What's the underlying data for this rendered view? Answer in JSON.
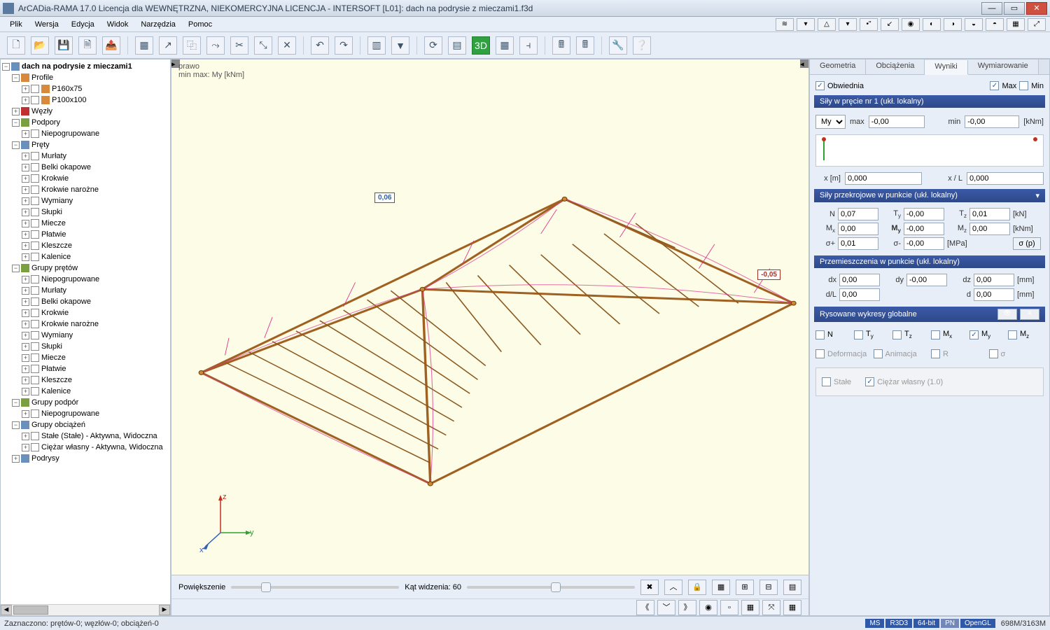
{
  "title": "ArCADia-RAMA 17.0 Licencja dla WEWNĘTRZNA, NIEKOMERCYJNA LICENCJA - INTERSOFT [L01]: dach na podrysie z mieczami1.f3d",
  "menu": [
    "Plik",
    "Wersja",
    "Edycja",
    "Widok",
    "Narzędzia",
    "Pomoc"
  ],
  "tree": {
    "root": "dach na podrysie z mieczami1",
    "profile": "Profile",
    "profiles": [
      "P160x75",
      "P100x100"
    ],
    "wezly": "Węzły",
    "podpory": "Podpory",
    "podpory_sub": [
      "Niepogrupowane"
    ],
    "prety": "Pręty",
    "prety_sub": [
      "Murłaty",
      "Belki okapowe",
      "Krokwie",
      "Krokwie narożne",
      "Wymiany",
      "Słupki",
      "Miecze",
      "Płatwie",
      "Kleszcze",
      "Kalenice"
    ],
    "grupy_pretow": "Grupy prętów",
    "grupy_pretow_sub": [
      "Niepogrupowane",
      "Murłaty",
      "Belki okapowe",
      "Krokwie",
      "Krokwie narożne",
      "Wymiany",
      "Słupki",
      "Miecze",
      "Płatwie",
      "Kleszcze",
      "Kalenice"
    ],
    "grupy_podpor": "Grupy podpór",
    "grupy_podpor_sub": [
      "Niepogrupowane"
    ],
    "grupy_obc": "Grupy obciążeń",
    "grupy_obc_sub": [
      "Stałe (Stałe) - Aktywna, Widoczna",
      "Ciężar własny - Aktywna, Widoczna"
    ],
    "podrysy": "Podrysy"
  },
  "viewport": {
    "label1": "prawo",
    "label2": "min max: My [kNm]",
    "annot_pos": "0,06",
    "annot_neg": "-0,05",
    "zoom_label": "Powiększenie",
    "angle_label": "Kąt widzenia: 60"
  },
  "right": {
    "tabs": [
      "Geometria",
      "Obciążenia",
      "Wyniki",
      "Wymiarowanie"
    ],
    "obwiednia": "Obwiednia",
    "max": "Max",
    "min": "Min",
    "sily_hdr": "Siły w pręcie nr 1 (ukł. lokalny)",
    "my_sel": "My",
    "max_lbl": "max",
    "max_val": "-0,00",
    "min_lbl": "min",
    "min_val": "-0,00",
    "unit_knm": "[kNm]",
    "x_lbl": "x [m]",
    "x_val": "0,000",
    "xl_lbl": "x / L",
    "xl_val": "0,000",
    "sily_przek_hdr": "Siły przekrojowe w punkcie (ukł. lokalny)",
    "N": "N",
    "N_v": "0,07",
    "Ty": "Ty",
    "Ty_v": "-0,00",
    "Tz": "Tz",
    "Tz_v": "0,01",
    "kn": "[kN]",
    "Mx": "Mx",
    "Mx_v": "0,00",
    "My": "My",
    "My_v": "-0,00",
    "Mz": "Mz",
    "Mz_v": "0,00",
    "sp": "σ+",
    "sp_v": "0,01",
    "sm": "σ-",
    "sm_v": "-0,00",
    "mpa": "[MPa]",
    "sigmap_btn": "σ (p)",
    "przem_hdr": "Przemieszczenia w punkcie (ukł. lokalny)",
    "dx": "dx",
    "dx_v": "0,00",
    "dy": "dy",
    "dy_v": "-0,00",
    "dz": "dz",
    "dz_v": "0,00",
    "mm": "[mm]",
    "dL": "d/L",
    "dL_v": "0,00",
    "d": "d",
    "d_v": "0,00",
    "rys_hdr": "Rysowane wykresy globalne",
    "plot_opts": [
      "N",
      "Ty",
      "Tz",
      "Mx",
      "My",
      "Mz"
    ],
    "def": "Deformacja",
    "anim": "Animacja",
    "R": "R",
    "sigma": "σ",
    "stale": "Stałe",
    "cw": "Ciężar własny (1.0)"
  },
  "status": {
    "left": "Zaznaczono: prętów-0; węzłów-0; obciążeń-0",
    "badges": [
      "MS",
      "R3D3",
      "64-bit",
      "PN",
      "OpenGL"
    ],
    "mem": "698M/3163M"
  }
}
